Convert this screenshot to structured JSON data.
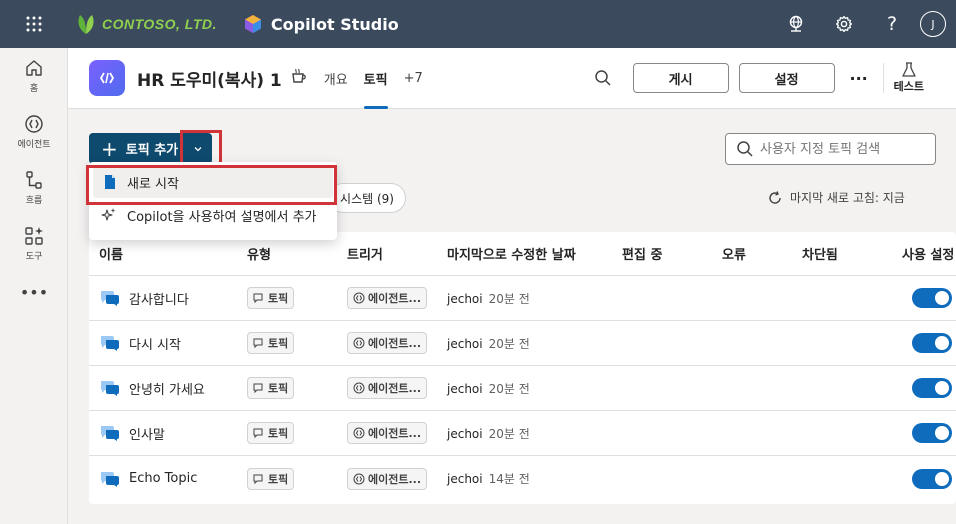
{
  "topbar": {
    "brand": "CONTOSO, LTD.",
    "product": "Copilot Studio",
    "help": "?",
    "avatar": "J"
  },
  "rail": {
    "items": [
      {
        "label": "홈",
        "icon": "home-icon"
      },
      {
        "label": "에이전트",
        "icon": "agent-icon"
      },
      {
        "label": "흐름",
        "icon": "flow-icon"
      },
      {
        "label": "도구",
        "icon": "tools-icon"
      }
    ],
    "more": "•••"
  },
  "header": {
    "agent_name": "HR 도우미(복사) 1",
    "tabs": [
      "개요",
      "토픽",
      "+7"
    ],
    "active_tab": "토픽",
    "publish": "게시",
    "settings": "설정",
    "more": "···",
    "test": "테스트"
  },
  "toolbar": {
    "add_topic": "토픽 추가",
    "search_placeholder": "사용자 지정 토픽 검색",
    "filter_system": "시스템 (9)",
    "refresh": "마지막 새로 고침: 지금"
  },
  "menu": {
    "items": [
      "새로 시작",
      "Copilot을 사용하여 설명에서 추가"
    ]
  },
  "table": {
    "headers": [
      "이름",
      "유형",
      "트리거",
      "마지막으로 수정한 날짜",
      "편집 중",
      "오류",
      "차단됨",
      "사용 설정"
    ],
    "rows": [
      {
        "name": "감사합니다",
        "type": "토픽",
        "trigger": "에이전트...",
        "user": "jechoi",
        "time": "20분 전"
      },
      {
        "name": "다시 시작",
        "type": "토픽",
        "trigger": "에이전트...",
        "user": "jechoi",
        "time": "20분 전"
      },
      {
        "name": "안녕히 가세요",
        "type": "토픽",
        "trigger": "에이전트...",
        "user": "jechoi",
        "time": "20분 전"
      },
      {
        "name": "인사말",
        "type": "토픽",
        "trigger": "에이전트...",
        "user": "jechoi",
        "time": "20분 전"
      },
      {
        "name": "Echo Topic",
        "type": "토픽",
        "trigger": "에이전트...",
        "user": "jechoi",
        "time": "14분 전"
      }
    ]
  },
  "colors": {
    "topbar": "#3b4a5c",
    "primary": "#0e4a6e",
    "accent": "#0f6cbd",
    "highlight": "#d13438"
  }
}
